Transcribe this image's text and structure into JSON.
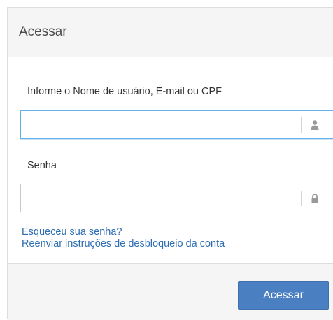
{
  "panel": {
    "title": "Acessar"
  },
  "form": {
    "username_label": "Informe o Nome de usuário, E-mail ou CPF",
    "username_value": "",
    "username_icon": "user-icon",
    "password_label": "Senha",
    "password_value": "",
    "password_icon": "lock-icon"
  },
  "links": {
    "forgot_password": "Esqueceu sua senha?",
    "resend_unlock": "Reenviar instruções de desbloqueio da conta"
  },
  "footer": {
    "submit_label": "Acessar"
  },
  "colors": {
    "accent": "#4a7fc1",
    "link": "#2f6db3",
    "focus_border": "#66afe9",
    "header_bg": "#f5f5f5"
  }
}
